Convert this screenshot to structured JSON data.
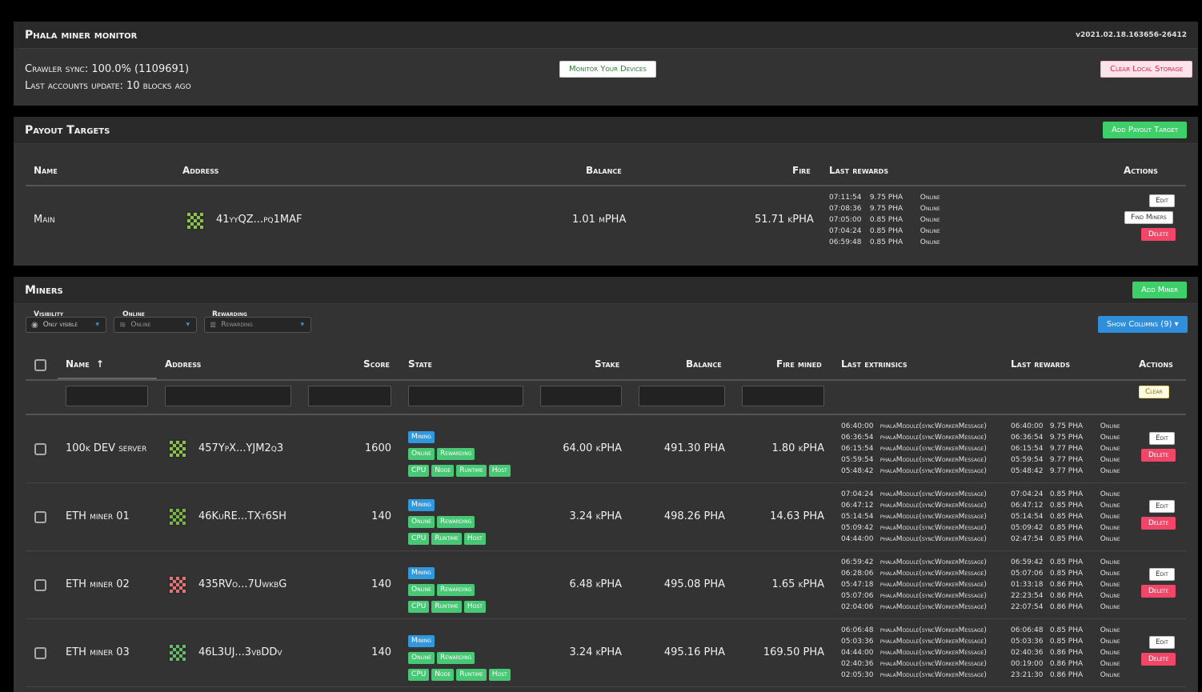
{
  "header": {
    "title": "Phala miner monitor",
    "version": "v2021.02.18.163656-26412",
    "crawler_sync": "Crawler sync: 100.0% (1109691)",
    "accounts_update": "Last accounts update: 10 blocks ago",
    "monitor_button": "Monitor Your Devices",
    "clear_button": "Clear Local Storage"
  },
  "payout": {
    "title": "Payout Targets",
    "add_button": "Add Payout Target",
    "columns": [
      "Name",
      "Address",
      "Balance",
      "Fire",
      "Last rewards",
      "Actions"
    ],
    "row": {
      "name": "Main",
      "address": "41yyQZ...pq1MAF",
      "balance": "1.01 mPHA",
      "fire": "51.71 kPHA",
      "rewards": [
        [
          "07:11:54",
          "9.75 PHA",
          "Online"
        ],
        [
          "07:08:36",
          "9.75 PHA",
          "Online"
        ],
        [
          "07:05:00",
          "0.85 PHA",
          "Online"
        ],
        [
          "07:04:24",
          "0.85 PHA",
          "Online"
        ],
        [
          "06:59:48",
          "0.85 PHA",
          "Online"
        ]
      ],
      "edit": "Edit",
      "find": "Find Miners",
      "delete": "Delete"
    }
  },
  "miners": {
    "title": "Miners",
    "add_button": "Add Miner",
    "filters": {
      "visibility_label": "Visibility",
      "visibility_value": "Only visible",
      "online_label": "Online",
      "online_value": "Online",
      "rewarding_label": "Rewarding",
      "rewarding_value": "Rewarding"
    },
    "show_columns": "Show Columns (9)",
    "columns": {
      "name": "Name",
      "address": "Address",
      "score": "Score",
      "state": "State",
      "stake": "Stake",
      "balance": "Balance",
      "fire": "Fire mined",
      "extrinsics": "Last extrinsics",
      "rewards": "Last rewards",
      "actions": "Actions"
    },
    "clear": "Clear",
    "edit": "Edit",
    "delete": "Delete",
    "rows": [
      {
        "name": "100k DEV server",
        "address": "457YpX...YJM2q3",
        "score": "1600",
        "tags_row1": [
          "Mining"
        ],
        "tags_row2": [
          "Online",
          "Rewarding"
        ],
        "tags_row3": [
          "CPU",
          "Node",
          "Runtime",
          "Host"
        ],
        "stake": "64.00 kPHA",
        "balance": "491.30 PHA",
        "fire": "1.80 kPHA",
        "extrinsics": [
          [
            "06:40:00",
            "phalaModule(syncWorkerMessage)"
          ],
          [
            "06:36:54",
            "phalaModule(syncWorkerMessage)"
          ],
          [
            "06:15:54",
            "phalaModule(syncWorkerMessage)"
          ],
          [
            "05:59:54",
            "phalaModule(syncWorkerMessage)"
          ],
          [
            "05:48:42",
            "phalaModule(syncWorkerMessage)"
          ]
        ],
        "rewards": [
          [
            "06:40:00",
            "9.75 PHA",
            "Online"
          ],
          [
            "06:36:54",
            "9.75 PHA",
            "Online"
          ],
          [
            "06:15:54",
            "9.77 PHA",
            "Online"
          ],
          [
            "05:59:54",
            "9.77 PHA",
            "Online"
          ],
          [
            "05:48:42",
            "9.77 PHA",
            "Online"
          ]
        ],
        "icon_color": "#8bc34a"
      },
      {
        "name": "ETH miner 01",
        "address": "46KuRE...TXт6SH",
        "score": "140",
        "tags_row1": [
          "Mining"
        ],
        "tags_row2": [
          "Online",
          "Rewarding"
        ],
        "tags_row3": [
          "CPU",
          "Runtime",
          "Host"
        ],
        "stake": "3.24 kPHA",
        "balance": "498.26 PHA",
        "fire": "14.63 PHA",
        "extrinsics": [
          [
            "07:04:24",
            "phalaModule(syncWorkerMessage)"
          ],
          [
            "06:47:12",
            "phalaModule(syncWorkerMessage)"
          ],
          [
            "05:14:54",
            "phalaModule(syncWorkerMessage)"
          ],
          [
            "05:09:42",
            "phalaModule(syncWorkerMessage)"
          ],
          [
            "04:44:00",
            "phalaModule(syncWorkerMessage)"
          ]
        ],
        "rewards": [
          [
            "07:04:24",
            "0.85 PHA",
            "Online"
          ],
          [
            "06:47:12",
            "0.85 PHA",
            "Online"
          ],
          [
            "05:14:54",
            "0.85 PHA",
            "Online"
          ],
          [
            "05:09:42",
            "0.85 PHA",
            "Online"
          ],
          [
            "02:47:54",
            "0.85 PHA",
            "Online"
          ]
        ],
        "icon_color": "#7cb342"
      },
      {
        "name": "ETH miner 02",
        "address": "435RVo...7UwkbG",
        "score": "140",
        "tags_row1": [
          "Mining"
        ],
        "tags_row2": [
          "Online",
          "Rewarding"
        ],
        "tags_row3": [
          "CPU",
          "Runtime",
          "Host"
        ],
        "stake": "6.48 kPHA",
        "balance": "495.08 PHA",
        "fire": "1.65 kPHA",
        "extrinsics": [
          [
            "06:59:42",
            "phalaModule(syncWorkerMessage)"
          ],
          [
            "06:28:06",
            "phalaModule(syncWorkerMessage)"
          ],
          [
            "05:47:18",
            "phalaModule(syncWorkerMessage)"
          ],
          [
            "05:07:06",
            "phalaModule(syncWorkerMessage)"
          ],
          [
            "02:04:06",
            "phalaModule(syncWorkerMessage)"
          ]
        ],
        "rewards": [
          [
            "06:59:42",
            "0.85 PHA",
            "Online"
          ],
          [
            "05:07:06",
            "0.85 PHA",
            "Online"
          ],
          [
            "01:33:18",
            "0.86 PHA",
            "Online"
          ],
          [
            "22:23:54",
            "0.86 PHA",
            "Online"
          ],
          [
            "22:07:54",
            "0.86 PHA",
            "Online"
          ]
        ],
        "icon_color": "#e57373"
      },
      {
        "name": "ETH miner 03",
        "address": "46L3UJ...3vbDDv",
        "score": "140",
        "tags_row1": [
          "Mining"
        ],
        "tags_row2": [
          "Online",
          "Rewarding"
        ],
        "tags_row3": [
          "CPU",
          "Node",
          "Runtime",
          "Host"
        ],
        "stake": "3.24 kPHA",
        "balance": "495.16 PHA",
        "fire": "169.50 PHA",
        "extrinsics": [
          [
            "06:06:48",
            "phalaModule(syncWorkerMessage)"
          ],
          [
            "05:03:36",
            "phalaModule(syncWorkerMessage)"
          ],
          [
            "04:44:00",
            "phalaModule(syncWorkerMessage)"
          ],
          [
            "02:40:36",
            "phalaModule(syncWorkerMessage)"
          ],
          [
            "02:05:30",
            "phalaModule(syncWorkerMessage)"
          ]
        ],
        "rewards": [
          [
            "06:06:48",
            "0.85 PHA",
            "Online"
          ],
          [
            "05:03:36",
            "0.85 PHA",
            "Online"
          ],
          [
            "02:40:36",
            "0.86 PHA",
            "Online"
          ],
          [
            "00:19:00",
            "0.86 PHA",
            "Online"
          ],
          [
            "23:21:30",
            "0.86 PHA",
            "Online"
          ]
        ],
        "icon_color": "#66bb6a"
      }
    ]
  }
}
